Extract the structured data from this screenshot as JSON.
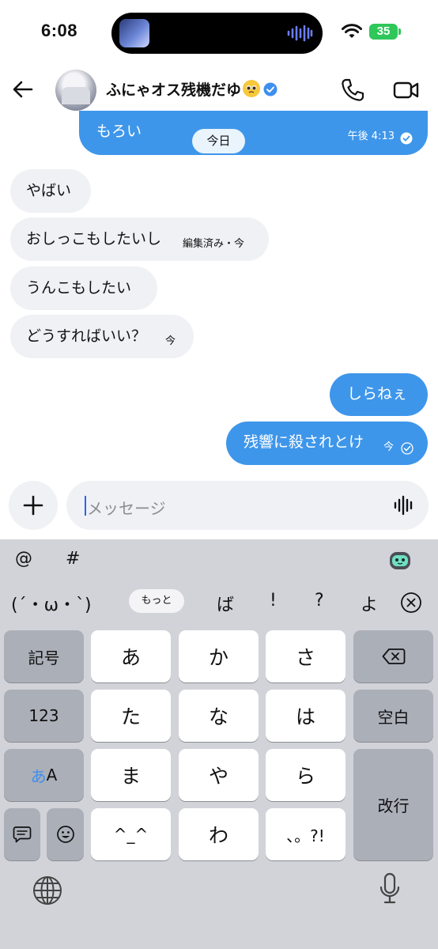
{
  "status_bar": {
    "time": "6:08",
    "battery": "35"
  },
  "header": {
    "contact_name": "ふにゃオス残機だゆ"
  },
  "chat": {
    "previous_message": {
      "text": "もろい",
      "time": "午後 4:13"
    },
    "date_separator": "今日",
    "messages": [
      {
        "direction": "incoming",
        "text": "やばい",
        "meta": ""
      },
      {
        "direction": "incoming",
        "text": "おしっこもしたいし",
        "meta": "編集済み・今"
      },
      {
        "direction": "incoming",
        "text": "うんこもしたい",
        "meta": ""
      },
      {
        "direction": "incoming",
        "text": "どうすればいい？",
        "meta": "今"
      },
      {
        "direction": "outgoing",
        "text": "しらねぇ",
        "meta": ""
      },
      {
        "direction": "outgoing",
        "text": "残響に殺されとけ",
        "meta": "今"
      }
    ]
  },
  "composer": {
    "placeholder": "メッセージ"
  },
  "keyboard": {
    "suggestion_row_1": [
      "@",
      "#"
    ],
    "suggestion_row_2": {
      "kaomoji": "(´・ω・`)",
      "more": "もっと",
      "chars": [
        "ば",
        "!",
        "?",
        "よ"
      ]
    },
    "keys": {
      "kigou": "記号",
      "num": "123",
      "mode_a": "あ",
      "mode_b": "A",
      "a": "あ",
      "ka": "か",
      "sa": "さ",
      "ta": "た",
      "na": "な",
      "ha": "は",
      "ma": "ま",
      "ya": "や",
      "ra": "ら",
      "kaomoji_key": "^_^",
      "wa": "わ",
      "punct": "、。?!",
      "space": "空白",
      "return": "改行"
    },
    "colors": {
      "mode_a_accent": "#3e8ff0"
    }
  },
  "colors": {
    "outgoing_bubble": "#3e96ea",
    "incoming_bubble": "#eff1f4",
    "keyboard_bg": "#d1d3d9"
  }
}
